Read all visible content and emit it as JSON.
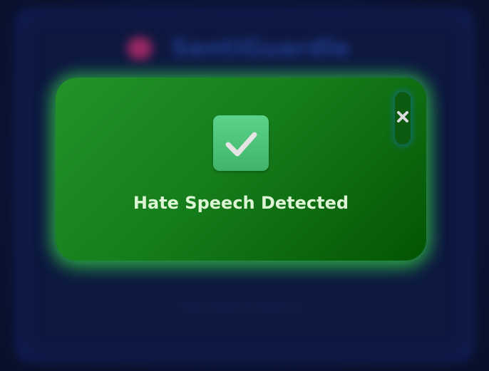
{
  "background_app": {
    "title": "SentiGuardle",
    "caption": "Hate Speech Detector"
  },
  "modal": {
    "title": "Hate Speech Detected",
    "close_icon": "close-icon",
    "status_icon": "checkmark-icon"
  },
  "colors": {
    "page_background": "#0a1230",
    "modal_gradient_start": "#24922a",
    "modal_gradient_end": "#035503",
    "modal_glow": "#3cdc50",
    "check_badge": "#4ec67a",
    "title_text": "#dcf5d4"
  }
}
